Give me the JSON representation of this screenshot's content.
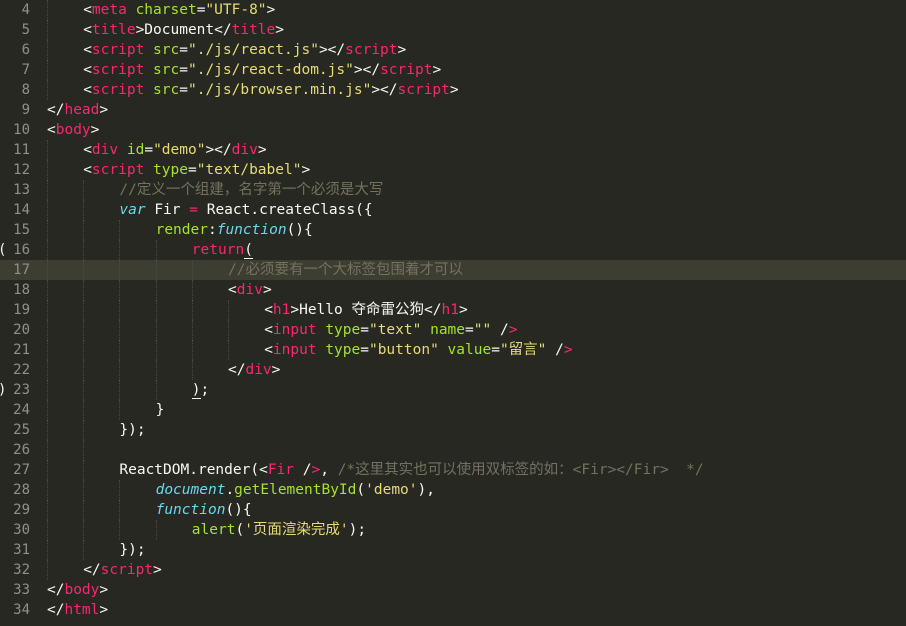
{
  "editor": {
    "colors": {
      "background": "#272822",
      "current_line": "#3e3d32",
      "tag": "#f92672",
      "attribute": "#a6e22e",
      "string": "#e6db74",
      "comment": "#75715e",
      "storage": "#66d9ef"
    },
    "lines": [
      {
        "num": "4",
        "indent": 1,
        "tokens": [
          [
            "t-tag-b",
            "<"
          ],
          [
            "t-tag",
            "meta"
          ],
          [
            "t-plain",
            " "
          ],
          [
            "t-attr",
            "charset"
          ],
          [
            "t-plain",
            "="
          ],
          [
            "t-str",
            "\"UTF-8\""
          ],
          [
            "t-plain",
            ">"
          ]
        ]
      },
      {
        "num": "5",
        "indent": 1,
        "tokens": [
          [
            "t-plain",
            "<"
          ],
          [
            "t-tag",
            "title"
          ],
          [
            "t-plain",
            ">Document</"
          ],
          [
            "t-tag",
            "title"
          ],
          [
            "t-plain",
            ">"
          ]
        ]
      },
      {
        "num": "6",
        "indent": 1,
        "tokens": [
          [
            "t-plain",
            "<"
          ],
          [
            "t-tag",
            "script"
          ],
          [
            "t-plain",
            " "
          ],
          [
            "t-attr",
            "src"
          ],
          [
            "t-plain",
            "="
          ],
          [
            "t-str",
            "\"./js/react.js\""
          ],
          [
            "t-plain",
            "></"
          ],
          [
            "t-tag",
            "script"
          ],
          [
            "t-plain",
            ">"
          ]
        ]
      },
      {
        "num": "7",
        "indent": 1,
        "tokens": [
          [
            "t-plain",
            "<"
          ],
          [
            "t-tag",
            "script"
          ],
          [
            "t-plain",
            " "
          ],
          [
            "t-attr",
            "src"
          ],
          [
            "t-plain",
            "="
          ],
          [
            "t-str",
            "\"./js/react-dom.js\""
          ],
          [
            "t-plain",
            "></"
          ],
          [
            "t-tag",
            "script"
          ],
          [
            "t-plain",
            ">"
          ]
        ]
      },
      {
        "num": "8",
        "indent": 1,
        "tokens": [
          [
            "t-plain",
            "<"
          ],
          [
            "t-tag",
            "script"
          ],
          [
            "t-plain",
            " "
          ],
          [
            "t-attr",
            "src"
          ],
          [
            "t-plain",
            "="
          ],
          [
            "t-str",
            "\"./js/browser.min.js\""
          ],
          [
            "t-plain",
            "></"
          ],
          [
            "t-tag",
            "script"
          ],
          [
            "t-plain",
            ">"
          ]
        ]
      },
      {
        "num": "9",
        "indent": 0,
        "tokens": [
          [
            "t-plain",
            "</"
          ],
          [
            "t-tag",
            "head"
          ],
          [
            "t-plain",
            ">"
          ]
        ]
      },
      {
        "num": "10",
        "indent": 0,
        "tokens": [
          [
            "t-plain",
            "<"
          ],
          [
            "t-tag",
            "body"
          ],
          [
            "t-plain",
            ">"
          ]
        ]
      },
      {
        "num": "11",
        "indent": 1,
        "tokens": [
          [
            "t-plain",
            "<"
          ],
          [
            "t-tag",
            "div"
          ],
          [
            "t-plain",
            " "
          ],
          [
            "t-attr",
            "id"
          ],
          [
            "t-plain",
            "="
          ],
          [
            "t-str",
            "\"demo\""
          ],
          [
            "t-plain",
            "></"
          ],
          [
            "t-tag",
            "div"
          ],
          [
            "t-plain",
            ">"
          ]
        ]
      },
      {
        "num": "12",
        "indent": 1,
        "tokens": [
          [
            "t-plain",
            "<"
          ],
          [
            "t-tag",
            "script"
          ],
          [
            "t-plain",
            " "
          ],
          [
            "t-attr",
            "type"
          ],
          [
            "t-plain",
            "="
          ],
          [
            "t-str",
            "\"text/babel\""
          ],
          [
            "t-plain",
            ">"
          ]
        ]
      },
      {
        "num": "13",
        "indent": 2,
        "tokens": [
          [
            "t-com",
            "//定义一个组建，名字第一个必须是大写"
          ]
        ]
      },
      {
        "num": "14",
        "indent": 2,
        "tokens": [
          [
            "t-storage",
            "var"
          ],
          [
            "t-plain",
            " Fir "
          ],
          [
            "t-kw",
            "="
          ],
          [
            "t-plain",
            " React.createClass({"
          ]
        ]
      },
      {
        "num": "15",
        "indent": 3,
        "tokens": [
          [
            "t-fn",
            "render"
          ],
          [
            "t-plain",
            ":"
          ],
          [
            "t-storage",
            "function"
          ],
          [
            "t-plain",
            "(){"
          ]
        ]
      },
      {
        "num": "16",
        "indent": 4,
        "fold": "(",
        "tokens": [
          [
            "t-kw",
            "return"
          ],
          [
            "t-plain-match",
            "("
          ]
        ]
      },
      {
        "num": "17",
        "indent": 5,
        "current": true,
        "tokens": [
          [
            "t-com",
            "//必须要有一个大标签包围着才可以"
          ]
        ]
      },
      {
        "num": "18",
        "indent": 5,
        "tokens": [
          [
            "t-plain",
            "<"
          ],
          [
            "t-tag",
            "div"
          ],
          [
            "t-plain",
            ">"
          ]
        ]
      },
      {
        "num": "19",
        "indent": 6,
        "tokens": [
          [
            "t-plain",
            "<"
          ],
          [
            "t-tag",
            "h1"
          ],
          [
            "t-plain",
            ">Hello 夺命雷公狗</"
          ],
          [
            "t-tag",
            "h1"
          ],
          [
            "t-plain",
            ">"
          ]
        ]
      },
      {
        "num": "20",
        "indent": 6,
        "tokens": [
          [
            "t-plain",
            "<"
          ],
          [
            "t-tag",
            "input"
          ],
          [
            "t-plain",
            " "
          ],
          [
            "t-attr",
            "type"
          ],
          [
            "t-plain",
            "="
          ],
          [
            "t-str",
            "\"text\""
          ],
          [
            "t-plain",
            " "
          ],
          [
            "t-attr",
            "name"
          ],
          [
            "t-plain",
            "="
          ],
          [
            "t-str",
            "\"\""
          ],
          [
            "t-plain",
            " /"
          ],
          [
            "t-tag",
            ">"
          ]
        ]
      },
      {
        "num": "21",
        "indent": 6,
        "tokens": [
          [
            "t-plain",
            "<"
          ],
          [
            "t-tag",
            "input"
          ],
          [
            "t-plain",
            " "
          ],
          [
            "t-attr",
            "type"
          ],
          [
            "t-plain",
            "="
          ],
          [
            "t-str",
            "\"button\""
          ],
          [
            "t-plain",
            " "
          ],
          [
            "t-attr",
            "value"
          ],
          [
            "t-plain",
            "="
          ],
          [
            "t-str",
            "\"留言\""
          ],
          [
            "t-plain",
            " /"
          ],
          [
            "t-tag",
            ">"
          ]
        ]
      },
      {
        "num": "22",
        "indent": 5,
        "tokens": [
          [
            "t-plain",
            "</"
          ],
          [
            "t-tag",
            "div"
          ],
          [
            "t-plain",
            ">"
          ]
        ]
      },
      {
        "num": "23",
        "indent": 4,
        "fold": ")",
        "tokens": [
          [
            "t-plain-match",
            ")"
          ],
          [
            "t-plain",
            ";"
          ]
        ]
      },
      {
        "num": "24",
        "indent": 3,
        "tokens": [
          [
            "t-plain",
            "}"
          ]
        ]
      },
      {
        "num": "25",
        "indent": 2,
        "tokens": [
          [
            "t-plain",
            "});"
          ]
        ]
      },
      {
        "num": "26",
        "indent": 2,
        "tokens": []
      },
      {
        "num": "27",
        "indent": 2,
        "tokens": [
          [
            "t-plain",
            "ReactDOM.render("
          ],
          [
            "t-plain",
            "<"
          ],
          [
            "t-tag",
            "Fir"
          ],
          [
            "t-plain",
            " /"
          ],
          [
            "t-tag",
            ">"
          ],
          [
            "t-plain",
            ", "
          ],
          [
            "t-com",
            "/*这里其实也可以使用双标签的如：<Fir></Fir>  */"
          ]
        ]
      },
      {
        "num": "28",
        "indent": 3,
        "tokens": [
          [
            "t-sup",
            "document"
          ],
          [
            "t-plain",
            "."
          ],
          [
            "t-fn",
            "getElementById"
          ],
          [
            "t-plain",
            "("
          ],
          [
            "t-str",
            "'demo'"
          ],
          [
            "t-plain",
            "),"
          ]
        ]
      },
      {
        "num": "29",
        "indent": 3,
        "tokens": [
          [
            "t-storage",
            "function"
          ],
          [
            "t-plain",
            "(){"
          ]
        ]
      },
      {
        "num": "30",
        "indent": 4,
        "tokens": [
          [
            "t-fn",
            "alert"
          ],
          [
            "t-plain",
            "("
          ],
          [
            "t-str",
            "'页面渲染完成'"
          ],
          [
            "t-plain",
            ");"
          ]
        ]
      },
      {
        "num": "31",
        "indent": 2,
        "tokens": [
          [
            "t-plain",
            "});"
          ]
        ]
      },
      {
        "num": "32",
        "indent": 1,
        "tokens": [
          [
            "t-plain",
            "</"
          ],
          [
            "t-tag",
            "script"
          ],
          [
            "t-plain",
            ">"
          ]
        ]
      },
      {
        "num": "33",
        "indent": 0,
        "tokens": [
          [
            "t-plain",
            "</"
          ],
          [
            "t-tag",
            "body"
          ],
          [
            "t-plain",
            ">"
          ]
        ]
      },
      {
        "num": "34",
        "indent": 0,
        "tokens": [
          [
            "t-plain",
            "</"
          ],
          [
            "t-tag",
            "html"
          ],
          [
            "t-plain",
            ">"
          ]
        ]
      }
    ]
  }
}
